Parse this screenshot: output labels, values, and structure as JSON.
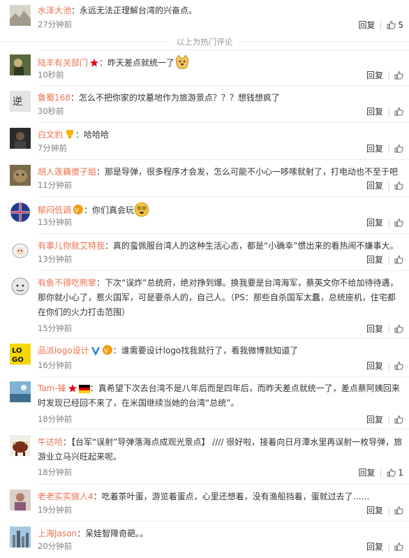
{
  "hot_divider": "以上为热门评论",
  "reply_label": "回复",
  "comments": [
    {
      "user": "水泽大池",
      "text": "：永远无法正理解台湾的兴奋点。",
      "time": "27分钟前",
      "likes": "5"
    },
    {
      "user": "陆丰有关部门",
      "text": "：昨天差点就统一了",
      "time": "10秒前",
      "likes": ""
    },
    {
      "user": "鲁蜀168",
      "text": "：怎么不把你家的坟墓地作为旅游景点？？？想钱想疯了",
      "time": "30秒前",
      "likes": ""
    },
    {
      "user": "白文豹",
      "text": "：哈哈哈",
      "time": "7分钟前",
      "likes": ""
    },
    {
      "user": "胡人莲藕傻子姐",
      "text": "：那是导弹，很多程序才会发，怎么可能不小心一哆嗦就射了，打电动也不至于吧",
      "time": "11分钟前",
      "likes": ""
    },
    {
      "user": "郁闷低调",
      "text": "：你们真会玩",
      "time": "13分钟前",
      "likes": ""
    },
    {
      "user": "有事儿你就艾特我",
      "text": "：真的蛮佩服台湾人的这种生活心态，都是“小确幸”惯出来的看热闹不嫌事大。",
      "time": "13分钟前",
      "likes": ""
    },
    {
      "user": "有鱼不得吃熊掌",
      "text": "：下次“误炸”总统府，绝对挣到爆。换我要是台湾海军，蔡英文你不给加待待遇，那你就小心了，惹火国军，可是要杀人的，自己人。（PS：那些自杀国军太蠢，总统座机，住宅都在你们的火力打击范围）",
      "time": "15分钟前",
      "likes": ""
    },
    {
      "user": "品派logo设计",
      "text": "：谁需要设计logo找我就行了，看我微博就知道了",
      "time": "16分钟前",
      "likes": ""
    },
    {
      "user": "Tam-锋",
      "text": "：真希望下次去台湾不是八年后而是四年后，而昨天差点就统一了，差点蔡阿姨回来时发现已经回不来了，在米国继续当她的台湾“总统”。",
      "time": "18分钟前",
      "likes": ""
    },
    {
      "user": "牛达哈",
      "text": "：【台军“误射”导弹落海点成观光景点】 //// 很好啦，接着向日月潭水里再误射一枚导弹，旅游业立马兴旺起来呢。",
      "time": "18分钟前",
      "likes": "1"
    },
    {
      "user": "老老实实做人4",
      "text": "：吃着茶叶蛋，游览着蛋点，心里还想着，没有渔船挡着，蛋就过去了……",
      "time": "19分钟前",
      "likes": ""
    },
    {
      "user": "上海Jason",
      "text": "：呆娃智障奇葩。。",
      "time": "20分钟前",
      "likes": ""
    }
  ]
}
